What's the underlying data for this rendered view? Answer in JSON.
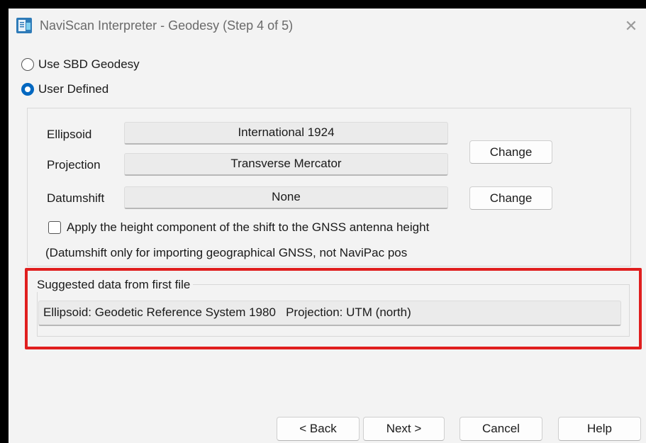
{
  "window": {
    "title": "NaviScan Interpreter - Geodesy (Step 4 of 5)",
    "close_glyph": "✕"
  },
  "geodesy_source": {
    "options": [
      {
        "label": "Use SBD Geodesy",
        "selected": false
      },
      {
        "label": "User Defined",
        "selected": true
      }
    ]
  },
  "user_defined": {
    "ellipsoid_label": "Ellipsoid",
    "ellipsoid_value": "International 1924",
    "projection_label": "Projection",
    "projection_value": "Transverse Mercator",
    "datumshift_label": "Datumshift",
    "datumshift_value": "None",
    "change_label": "Change",
    "apply_height_label": "Apply the height component of the shift to the GNSS antenna height",
    "apply_height_checked": false,
    "note": "(Datumshift only for importing geographical GNSS, not NaviPac pos"
  },
  "suggested": {
    "title": "Suggested data from first file",
    "text": "Ellipsoid: Geodetic Reference System 1980   Projection: UTM (north)"
  },
  "footer": {
    "back_label": "< Back",
    "next_label": "Next >",
    "cancel_label": "Cancel",
    "help_label": "Help"
  },
  "colors": {
    "accent": "#0067c0",
    "highlight": "#e01e1e",
    "window_bg": "#f3f3f3"
  }
}
